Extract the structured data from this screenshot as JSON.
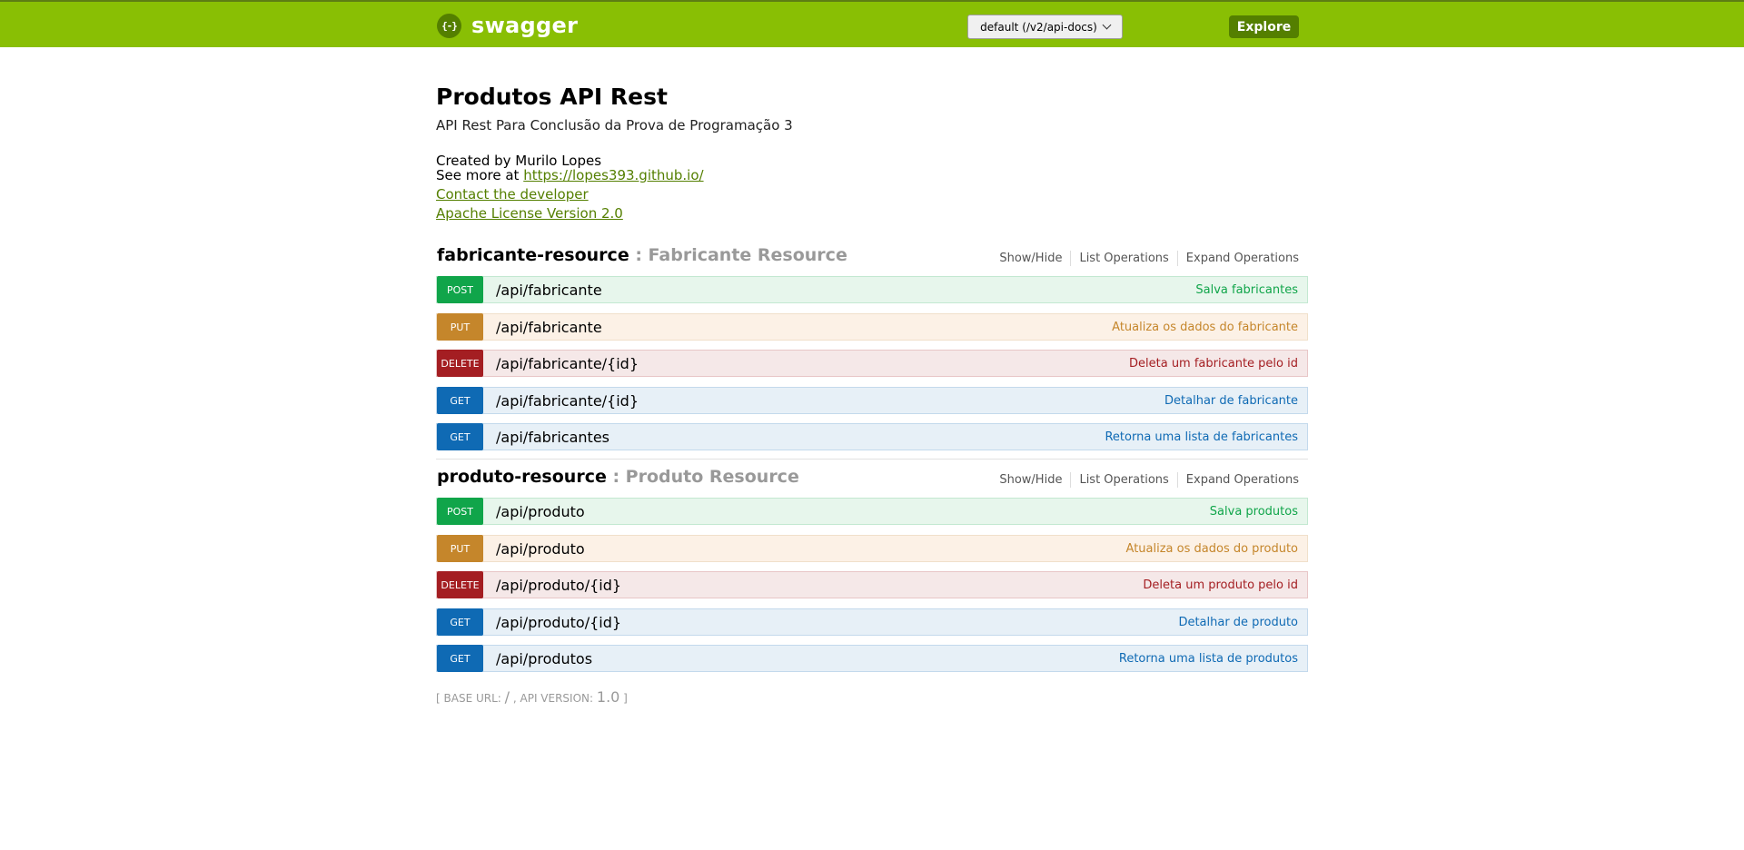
{
  "header": {
    "logo_icon": "{-}",
    "logo_text": "swagger",
    "api_selector": "default (/v2/api-docs)",
    "explore_label": "Explore",
    "bar_color": "#89bf04"
  },
  "info": {
    "title": "Produtos API Rest",
    "description": "API Rest Para Conclusão da Prova de Programação 3",
    "created_by": "Created by Murilo Lopes",
    "see_more_prefix": "See more at ",
    "see_more_link": "https://lopes393.github.io/",
    "contact_link": "Contact the developer",
    "license_link": "Apache License Version 2.0"
  },
  "resource_ops": {
    "show_hide": "Show/Hide",
    "list_operations": "List Operations",
    "expand_operations": "Expand Operations"
  },
  "resources": [
    {
      "name": "fabricante-resource",
      "subtitle": ": Fabricante Resource",
      "endpoints": [
        {
          "method": "POST",
          "path": "/api/fabricante",
          "summary": "Salva fabricantes"
        },
        {
          "method": "PUT",
          "path": "/api/fabricante",
          "summary": "Atualiza os dados do fabricante"
        },
        {
          "method": "DELETE",
          "path": "/api/fabricante/{id}",
          "summary": "Deleta um fabricante pelo id"
        },
        {
          "method": "GET",
          "path": "/api/fabricante/{id}",
          "summary": "Detalhar de fabricante"
        },
        {
          "method": "GET",
          "path": "/api/fabricantes",
          "summary": "Retorna uma lista de fabricantes"
        }
      ]
    },
    {
      "name": "produto-resource",
      "subtitle": ": Produto Resource",
      "endpoints": [
        {
          "method": "POST",
          "path": "/api/produto",
          "summary": "Salva produtos"
        },
        {
          "method": "PUT",
          "path": "/api/produto",
          "summary": "Atualiza os dados do produto"
        },
        {
          "method": "DELETE",
          "path": "/api/produto/{id}",
          "summary": "Deleta um produto pelo id"
        },
        {
          "method": "GET",
          "path": "/api/produto/{id}",
          "summary": "Detalhar de produto"
        },
        {
          "method": "GET",
          "path": "/api/produtos",
          "summary": "Retorna uma lista de produtos"
        }
      ]
    }
  ],
  "footer": {
    "open_bracket": "[",
    "base_url_label": "BASE URL:",
    "base_url_value": "/",
    "api_version_label": ", API VERSION:",
    "api_version_value": "1.0",
    "close_bracket": "]"
  }
}
